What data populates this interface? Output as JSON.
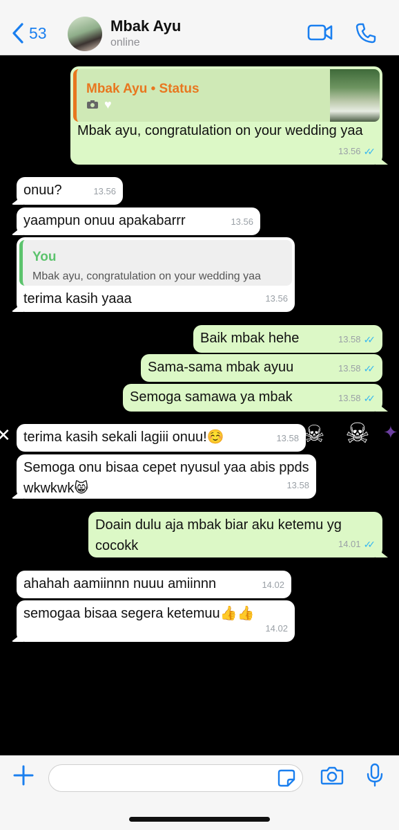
{
  "header": {
    "back_count": "53",
    "contact_name": "Mbak Ayu",
    "contact_status": "online"
  },
  "messages": [
    {
      "direction": "out",
      "quote_title": "Mbak Ayu • Status",
      "text": "Mbak ayu, congratulation on your wedding yaa",
      "time": "13.56"
    },
    {
      "direction": "in",
      "text": "onuu?",
      "time": "13.56"
    },
    {
      "direction": "in",
      "text": "yaampun onuu apakabarrr",
      "time": "13.56"
    },
    {
      "direction": "in",
      "quote_title": "You",
      "quote_text": "Mbak ayu, congratulation on your wedding yaa",
      "text": "terima kasih yaaa",
      "time": "13.56"
    },
    {
      "direction": "out",
      "text": "Baik mbak hehe",
      "time": "13.58"
    },
    {
      "direction": "out",
      "text": "Sama-sama mbak ayuu",
      "time": "13.58"
    },
    {
      "direction": "out",
      "text": "Semoga samawa ya mbak",
      "time": "13.58"
    },
    {
      "direction": "in",
      "text": "terima kasih sekali lagiii onuu!☺️",
      "time": "13.58"
    },
    {
      "direction": "in",
      "text": "Semoga onu bisaa cepet nyusul yaa abis ppds wkwkwk😸",
      "time": "13.58"
    },
    {
      "direction": "out",
      "text": "Doain dulu aja mbak biar aku ketemu yg cocokk",
      "time": "14.01"
    },
    {
      "direction": "in",
      "text": "ahahah aamiinnn nuuu amiinnn",
      "time": "14.02"
    },
    {
      "direction": "in",
      "text": "semogaa bisaa segera ketemuu👍👍",
      "time": "14.02"
    }
  ],
  "colors": {
    "accent": "#1a7fef",
    "outgoing_bubble": "#dcf8c6",
    "incoming_bubble": "#ffffff",
    "status_quote": "#e8771f",
    "you_quote": "#5cc36d",
    "read_ticks": "#34b7f1"
  },
  "icons": [
    "chevron-left-icon",
    "video-call-icon",
    "phone-icon",
    "camera-icon",
    "heart-icon",
    "plus-icon",
    "sticker-icon",
    "mic-icon",
    "double-check-icon"
  ]
}
